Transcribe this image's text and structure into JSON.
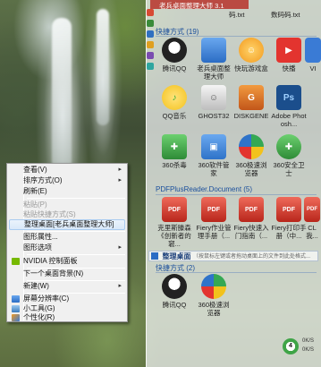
{
  "window": {
    "title": "老兵桌面整理大师 3.1"
  },
  "top_files": [
    "码.txt",
    "数码码.txt"
  ],
  "groups": [
    {
      "header": "快捷方式 (19)",
      "icons": [
        {
          "label": "腾讯QQ",
          "icon": "qq-penguin-icon",
          "color": "#222"
        },
        {
          "label": "老兵桌面整理大师",
          "icon": "monitor-icon",
          "color": "#2b6cc4"
        },
        {
          "label": "快玩游戏盒",
          "icon": "game-box-icon",
          "color": "#f29a1f"
        },
        {
          "label": "快播",
          "icon": "qvod-player-icon",
          "color": "#e3342f"
        },
        {
          "label": "VI",
          "icon": "app-icon",
          "color": "#3a7bd5"
        },
        {
          "label": "QQ音乐",
          "icon": "qq-music-icon",
          "color": "#f3c11c"
        },
        {
          "label": "GHOST32",
          "icon": "ghost-icon",
          "color": "#d0d0d0"
        },
        {
          "label": "DISKGENE",
          "icon": "diskgenius-icon",
          "color": "#e07a1f"
        },
        {
          "label": "Adobe Photosh...",
          "icon": "photoshop-icon",
          "color": "#1b4e8c"
        },
        {
          "label": "360杀毒",
          "icon": "360-antivirus-icon",
          "color": "#3fa447"
        },
        {
          "label": "360软件管家",
          "icon": "360-software-icon",
          "color": "#2f73c9"
        },
        {
          "label": "360极速浏览器",
          "icon": "360-browser-icon",
          "color": "#35a853"
        },
        {
          "label": "360安全卫士",
          "icon": "360-security-icon",
          "color": "#3fa447"
        }
      ]
    },
    {
      "header": "PDFPlusReader.Document (5)",
      "icons": [
        {
          "label": "克里斯滕森《创新者的窘...",
          "icon": "pdf-icon",
          "color": "#d23b2e"
        },
        {
          "label": "Fiery作业管理手册（...",
          "icon": "pdf-icon",
          "color": "#d23b2e"
        },
        {
          "label": "Fiery快速入门指南（...",
          "icon": "pdf-icon",
          "color": "#d23b2e"
        },
        {
          "label": "Fiery打印手册（中...",
          "icon": "pdf-icon",
          "color": "#d23b2e"
        },
        {
          "label": "CL 我...",
          "icon": "pdf-icon",
          "color": "#d23b2e"
        }
      ]
    },
    {
      "header": "快捷方式 (2)",
      "icons": [
        {
          "label": "腾讯QQ",
          "icon": "qq-penguin-icon",
          "color": "#222"
        },
        {
          "label": "360极速浏览器",
          "icon": "360-browser-icon",
          "color": "#35a853"
        }
      ]
    }
  ],
  "desk_bar": {
    "title": "整理桌面",
    "hint": "（按鼠标左键或者拖动桌面上的文件到此处格式..."
  },
  "context_menu": {
    "items": [
      {
        "label": "查看(V)",
        "arrow": "▸",
        "disabled": false
      },
      {
        "label": "排序方式(O)",
        "arrow": "▸",
        "disabled": false
      },
      {
        "label": "刷新(E)",
        "arrow": "",
        "disabled": false
      },
      {
        "label": "粘贴(P)",
        "arrow": "",
        "disabled": true
      },
      {
        "label": "粘贴快捷方式(S)",
        "arrow": "",
        "disabled": true
      },
      {
        "label": "整理桌面[老兵桌面整理大师]",
        "arrow": "",
        "disabled": false,
        "highlight": true
      },
      {
        "label": "图形属性...",
        "arrow": "",
        "disabled": false
      },
      {
        "label": "图形选项",
        "arrow": "▸",
        "disabled": false
      },
      {
        "label": "NVIDIA 控制面板",
        "arrow": "",
        "disabled": false,
        "icon": "nvidia-icon"
      },
      {
        "label": "下一个桌面背景(N)",
        "arrow": "",
        "disabled": false
      },
      {
        "label": "新建(W)",
        "arrow": "▸",
        "disabled": false
      },
      {
        "label": "屏幕分辨率(C)",
        "arrow": "",
        "disabled": false,
        "icon": "monitor-icon"
      },
      {
        "label": "小工具(G)",
        "arrow": "",
        "disabled": false,
        "icon": "gadgets-icon"
      },
      {
        "label": "个性化(R)",
        "arrow": "",
        "disabled": false,
        "icon": "personalize-icon"
      }
    ]
  },
  "tray": {
    "line1": "0K/S",
    "line2": "0K/S",
    "percent": "4"
  }
}
